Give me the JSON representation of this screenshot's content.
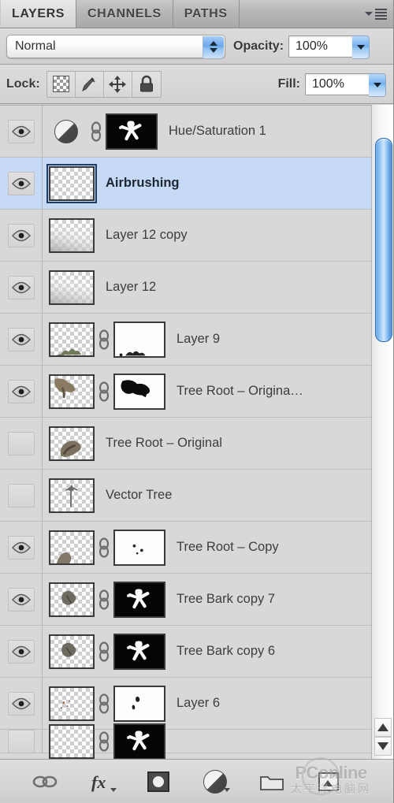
{
  "tabs": [
    {
      "label": "LAYERS",
      "active": true
    },
    {
      "label": "CHANNELS",
      "active": false
    },
    {
      "label": "PATHS",
      "active": false
    }
  ],
  "panel_menu": {
    "icon": "panel-menu-icon"
  },
  "controls": {
    "blend_mode": "Normal",
    "opacity_label": "Opacity:",
    "opacity_value": "100%",
    "fill_label": "Fill:",
    "fill_value": "100%",
    "lock_label": "Lock:",
    "lock_buttons": [
      {
        "name": "lock-transparent-pixels",
        "icon": "checkerboard-icon"
      },
      {
        "name": "lock-image-pixels",
        "icon": "brush-icon"
      },
      {
        "name": "lock-position",
        "icon": "move-cross-icon"
      },
      {
        "name": "lock-all",
        "icon": "padlock-icon"
      }
    ]
  },
  "layers": [
    {
      "name": "Hue/Saturation 1",
      "visible": true,
      "selected": false,
      "kind": "adjustment",
      "adjustment_icon": "half-circle-adjustment-icon",
      "has_link": true,
      "mask": "black",
      "mask_art": "white-figure-silhouette"
    },
    {
      "name": "Airbrushing",
      "visible": true,
      "selected": true,
      "kind": "pixel",
      "thumb": "transparent-empty",
      "has_link": false,
      "mask": "none"
    },
    {
      "name": "Layer 12 copy",
      "visible": true,
      "selected": false,
      "kind": "pixel",
      "thumb": "transparent-soft-gradient",
      "has_link": false,
      "mask": "none"
    },
    {
      "name": "Layer 12",
      "visible": true,
      "selected": false,
      "kind": "pixel",
      "thumb": "transparent-soft-gradient",
      "has_link": false,
      "mask": "none"
    },
    {
      "name": "Layer 9",
      "visible": true,
      "selected": false,
      "kind": "pixel",
      "thumb": "transparent-small-foliage",
      "has_link": true,
      "mask": "white",
      "mask_art": "small-dark-marks"
    },
    {
      "name": "Tree Root – Origina…",
      "visible": true,
      "selected": false,
      "kind": "pixel",
      "thumb": "transparent-root-texture",
      "has_link": true,
      "mask": "white",
      "mask_art": "black-root-shape"
    },
    {
      "name": "Tree Root – Original",
      "visible": false,
      "selected": false,
      "kind": "pixel",
      "thumb": "transparent-root-photo",
      "has_link": false,
      "mask": "none"
    },
    {
      "name": "Vector Tree",
      "visible": false,
      "selected": false,
      "kind": "pixel",
      "thumb": "transparent-small-tree",
      "has_link": false,
      "mask": "none"
    },
    {
      "name": "Tree Root – Copy",
      "visible": true,
      "selected": false,
      "kind": "pixel",
      "thumb": "transparent-root-bottom",
      "has_link": true,
      "mask": "white",
      "mask_art": "few-dark-dots"
    },
    {
      "name": "Tree Bark copy 7",
      "visible": true,
      "selected": false,
      "kind": "pixel",
      "thumb": "transparent-bark-clump",
      "has_link": true,
      "mask": "black",
      "mask_art": "white-figure-silhouette"
    },
    {
      "name": "Tree Bark copy 6",
      "visible": true,
      "selected": false,
      "kind": "pixel",
      "thumb": "transparent-bark-clump",
      "has_link": true,
      "mask": "black",
      "mask_art": "white-figure-silhouette"
    },
    {
      "name": "Layer 6",
      "visible": true,
      "selected": false,
      "kind": "pixel",
      "thumb": "transparent-tiny-specks",
      "has_link": true,
      "mask": "white",
      "mask_art": "tiny-dark-marks"
    },
    {
      "name": "",
      "visible": false,
      "selected": false,
      "kind": "pixel",
      "thumb": "transparent-empty",
      "has_link": true,
      "mask": "black",
      "mask_art": "white-figure-silhouette",
      "partial": true
    }
  ],
  "scrollbar": {
    "thumb_top_pct": 5,
    "thumb_height_pct": 31
  },
  "bottom_toolbar": [
    {
      "name": "link-layers-button",
      "icon": "chain-link-icon"
    },
    {
      "name": "layer-style-button",
      "icon": "fx-icon",
      "label": "fx"
    },
    {
      "name": "add-layer-mask-button",
      "icon": "mask-circle-icon"
    },
    {
      "name": "new-adjustment-layer-button",
      "icon": "half-circle-adjustment-icon"
    },
    {
      "name": "new-group-button",
      "icon": "folder-icon"
    },
    {
      "name": "new-layer-button",
      "icon": "new-layer-icon"
    }
  ],
  "watermark": {
    "top": "PConline",
    "bottom": "太平洋电脑网"
  },
  "colors": {
    "panel_bg": "#d8d8d8",
    "selected_row": "#c6d9f5",
    "scrollbar_blue": "#5b9fe4",
    "text": "#3d3d3d"
  }
}
